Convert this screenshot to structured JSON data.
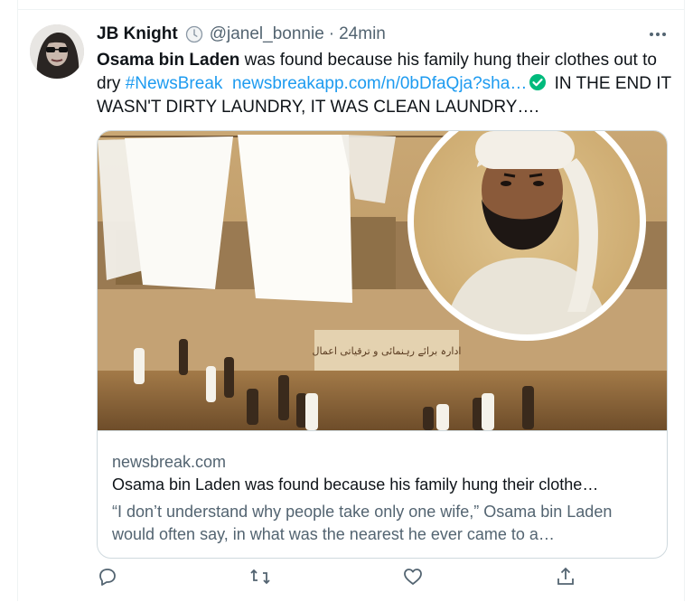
{
  "tweet": {
    "author_name": "JB Knight",
    "handle": "@janel_bonnie",
    "separator": "·",
    "time": "24min",
    "text_bold": "Osama bin Laden",
    "text_1": " was found because his family hung their clothes out to dry ",
    "hashtag": "#NewsBreak",
    "url": "newsbreakapp.com/n/0bDfaQja?sha…",
    "text_2": " IN THE END IT WASN'T DIRTY LAUNDRY, IT WAS CLEAN LAUNDRY…."
  },
  "card": {
    "domain": "newsbreak.com",
    "title": "Osama bin Laden was found because his family hung their clothe…",
    "description": "“I don’t understand why people take only one wife,” Osama bin Laden would often say, in what was the nearest he ever came to a…",
    "image_text": "ادارہ برائے رہنمائی و ترقیاتی اعمال"
  },
  "colors": {
    "link": "#1d9bf0",
    "secondary_text": "#536471",
    "border": "#cfd9de",
    "verified_green": "#00ba7c"
  },
  "icons": [
    "more-icon",
    "reply-icon",
    "retweet-icon",
    "like-icon",
    "share-icon"
  ]
}
